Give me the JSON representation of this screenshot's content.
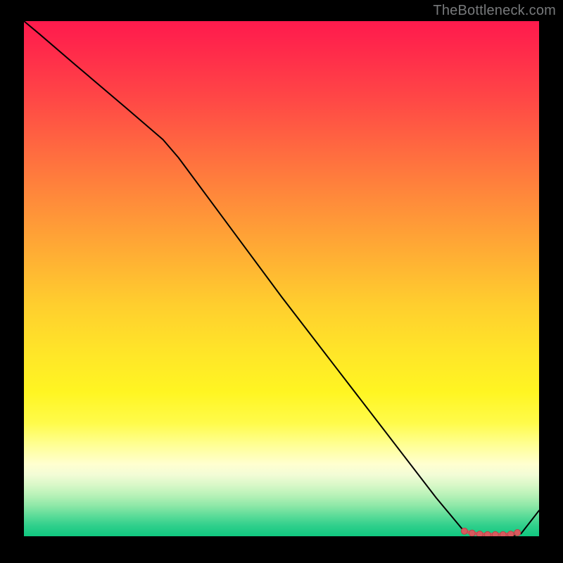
{
  "attribution": "TheBottleneck.com",
  "colors": {
    "line": "#000000",
    "marker": "#d85a5e",
    "marker_stroke": "#b84448"
  },
  "chart_data": {
    "type": "line",
    "title": "",
    "xlabel": "",
    "ylabel": "",
    "xlim": [
      0,
      1
    ],
    "ylim": [
      0,
      1
    ],
    "grid": false,
    "legend": false,
    "notes": "Image shows a red→yellow→green vertical gradient inside a black frame with a black polyline and a short coral marker segment near the bottom-right. No axis tick labels or numeric data labels are rendered — values are estimated from pixel position, normalised to [0,1].",
    "series": [
      {
        "name": "line",
        "x": [
          0.0,
          0.03,
          0.1,
          0.2,
          0.27,
          0.3,
          0.4,
          0.5,
          0.6,
          0.7,
          0.8,
          0.85,
          0.87,
          0.89,
          0.91,
          0.93,
          0.95,
          0.965,
          1.0
        ],
        "y": [
          1.0,
          0.975,
          0.915,
          0.83,
          0.77,
          0.735,
          0.6,
          0.465,
          0.335,
          0.205,
          0.075,
          0.015,
          0.005,
          0.001,
          0.0,
          0.0,
          0.001,
          0.005,
          0.05
        ]
      }
    ],
    "markers": {
      "name": "highlight",
      "x": [
        0.855,
        0.87,
        0.885,
        0.9,
        0.915,
        0.93,
        0.945,
        0.958
      ],
      "y": [
        0.01,
        0.006,
        0.004,
        0.003,
        0.003,
        0.003,
        0.004,
        0.007
      ]
    }
  }
}
